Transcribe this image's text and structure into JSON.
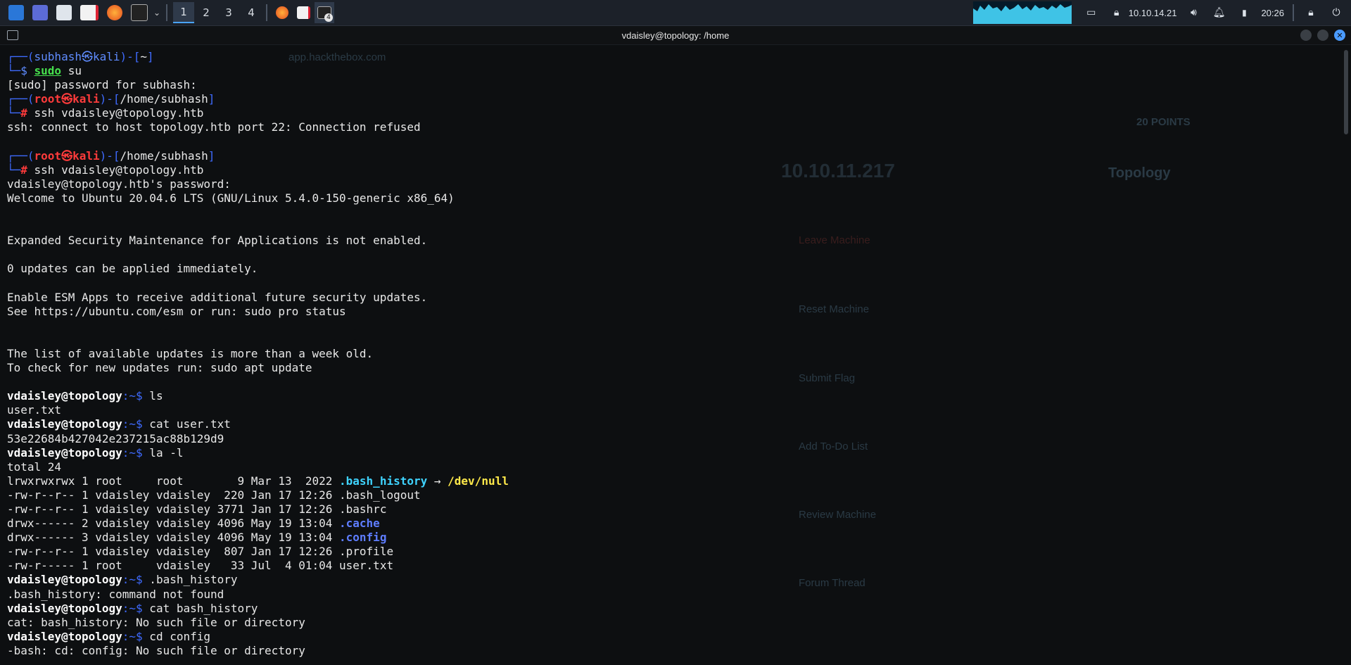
{
  "taskbar": {
    "workspaces": [
      "1",
      "2",
      "3",
      "4"
    ],
    "active_workspace": "1",
    "badge": "4",
    "ip": "10.10.14.21",
    "time": "20:26"
  },
  "window": {
    "title": "vdaisley@topology: /home"
  },
  "terminal": {
    "lines": [
      {
        "k": "prompt_user",
        "user": "subhash",
        "host": "kali",
        "path": "~"
      },
      {
        "k": "cmd_user",
        "cmd": "sudo",
        "arg": " su"
      },
      {
        "k": "plain",
        "text": "[sudo] password for subhash:"
      },
      {
        "k": "prompt_root",
        "user": "root",
        "host": "kali",
        "path": "/home/subhash"
      },
      {
        "k": "cmd_root",
        "text": "ssh vdaisley@topology.htb"
      },
      {
        "k": "plain",
        "text": "ssh: connect to host topology.htb port 22: Connection refused"
      },
      {
        "k": "plain",
        "text": ""
      },
      {
        "k": "prompt_root",
        "user": "root",
        "host": "kali",
        "path": "/home/subhash"
      },
      {
        "k": "cmd_root",
        "text": "ssh vdaisley@topology.htb"
      },
      {
        "k": "plain",
        "text": "vdaisley@topology.htb's password:"
      },
      {
        "k": "plain",
        "text": "Welcome to Ubuntu 20.04.6 LTS (GNU/Linux 5.4.0-150-generic x86_64)"
      },
      {
        "k": "plain",
        "text": ""
      },
      {
        "k": "plain",
        "text": ""
      },
      {
        "k": "plain",
        "text": "Expanded Security Maintenance for Applications is not enabled."
      },
      {
        "k": "plain",
        "text": ""
      },
      {
        "k": "plain",
        "text": "0 updates can be applied immediately."
      },
      {
        "k": "plain",
        "text": ""
      },
      {
        "k": "plain",
        "text": "Enable ESM Apps to receive additional future security updates."
      },
      {
        "k": "plain",
        "text": "See https://ubuntu.com/esm or run: sudo pro status"
      },
      {
        "k": "plain",
        "text": ""
      },
      {
        "k": "plain",
        "text": ""
      },
      {
        "k": "plain",
        "text": "The list of available updates is more than a week old."
      },
      {
        "k": "plain",
        "text": "To check for new updates run: sudo apt update"
      },
      {
        "k": "plain",
        "text": ""
      },
      {
        "k": "vprompt",
        "user": "vdaisley@topology",
        "path": ":~$",
        "cmd": " ls"
      },
      {
        "k": "plain",
        "text": "user.txt"
      },
      {
        "k": "vprompt",
        "user": "vdaisley@topology",
        "path": ":~$",
        "cmd": " cat user.txt"
      },
      {
        "k": "plain",
        "text": "53e22684b427042e237215ac88b129d9"
      },
      {
        "k": "vprompt",
        "user": "vdaisley@topology",
        "path": ":~$",
        "cmd": " la -l"
      },
      {
        "k": "plain",
        "text": "total 24"
      },
      {
        "k": "ls",
        "pre": "lrwxrwxrwx 1 root     root        9 Mar 13  2022 ",
        "name": ".bash_history",
        "cls": "c-cyan",
        "post": " → ",
        "target": "/dev/null"
      },
      {
        "k": "ls",
        "pre": "-rw-r--r-- 1 vdaisley vdaisley  220 Jan 17 12:26 ",
        "name": ".bash_logout",
        "cls": "c-white",
        "post": "",
        "target": ""
      },
      {
        "k": "ls",
        "pre": "-rw-r--r-- 1 vdaisley vdaisley 3771 Jan 17 12:26 ",
        "name": ".bashrc",
        "cls": "c-white",
        "post": "",
        "target": ""
      },
      {
        "k": "ls",
        "pre": "drwx------ 2 vdaisley vdaisley 4096 May 19 13:04 ",
        "name": ".cache",
        "cls": "c-dirblue",
        "post": "",
        "target": ""
      },
      {
        "k": "ls",
        "pre": "drwx------ 3 vdaisley vdaisley 4096 May 19 13:04 ",
        "name": ".config",
        "cls": "c-dirblue",
        "post": "",
        "target": ""
      },
      {
        "k": "ls",
        "pre": "-rw-r--r-- 1 vdaisley vdaisley  807 Jan 17 12:26 ",
        "name": ".profile",
        "cls": "c-white",
        "post": "",
        "target": ""
      },
      {
        "k": "ls",
        "pre": "-rw-r----- 1 root     vdaisley   33 Jul  4 01:04 ",
        "name": "user.txt",
        "cls": "c-white",
        "post": "",
        "target": ""
      },
      {
        "k": "vprompt",
        "user": "vdaisley@topology",
        "path": ":~$",
        "cmd": " .bash_history"
      },
      {
        "k": "plain",
        "text": ".bash_history: command not found"
      },
      {
        "k": "vprompt",
        "user": "vdaisley@topology",
        "path": ":~$",
        "cmd": " cat bash_history"
      },
      {
        "k": "plain",
        "text": "cat: bash_history: No such file or directory"
      },
      {
        "k": "vprompt",
        "user": "vdaisley@topology",
        "path": ":~$",
        "cmd": " cd config"
      },
      {
        "k": "plain",
        "text": "-bash: cd: config: No such file or directory"
      }
    ]
  },
  "background": {
    "ip": "10.10.11.217",
    "machine": "Topology",
    "points": "20 POINTS",
    "menu": [
      "Leave Machine",
      "Reset Machine",
      "Submit Flag",
      "Add To-Do List",
      "Review Machine",
      "Forum Thread"
    ],
    "url": "app.hackthebox.com"
  }
}
